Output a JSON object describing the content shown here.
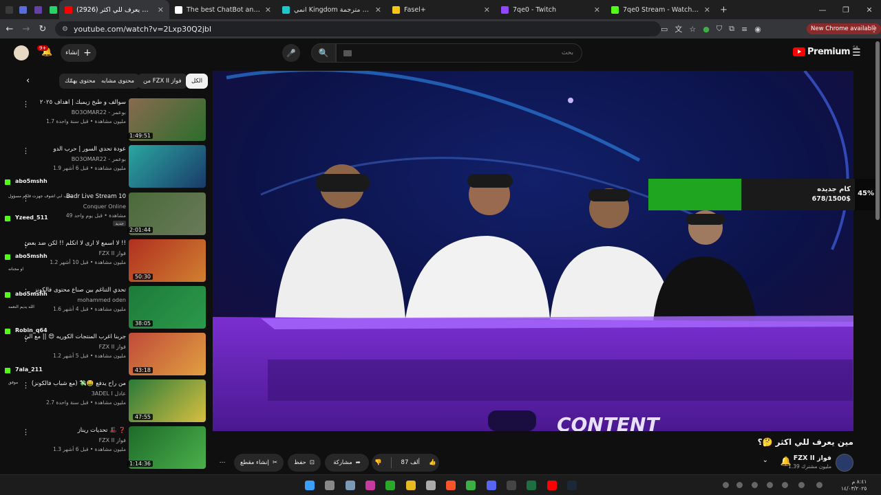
{
  "browser": {
    "tabs": [
      {
        "label": "",
        "color": "#3a3a3a",
        "active": false
      },
      {
        "label": "",
        "color": "#5a6cd8",
        "active": false
      },
      {
        "label": "",
        "color": "#6441a5",
        "active": false
      },
      {
        "label": "",
        "color": "#25d366",
        "active": false
      },
      {
        "label": "(2926) مين يعرف للي اكثر 🤔",
        "color": "#ff0000",
        "active": true
      },
      {
        "label": "The best ChatBot and Widgets",
        "color": "#ffffff",
        "active": false
      },
      {
        "label": "انمي Kingdom الحلقة 10 مترجمة",
        "color": "#1ec8c8",
        "active": false
      },
      {
        "label": "Fasel+",
        "color": "#f5c518",
        "active": false
      },
      {
        "label": "7qe0 - Twitch",
        "color": "#9146ff",
        "active": false
      },
      {
        "label": "7qe0 Stream - Watch Live on K",
        "color": "#53fc18",
        "active": false
      }
    ],
    "url": "youtube.com/watch?v=2Lxp30Q2jbI",
    "new_chrome": "New Chrome available"
  },
  "youtube": {
    "notif_count": "9+",
    "create_label": "إنشاء",
    "search_placeholder": "بحث",
    "logo_text": "Premium",
    "logo_region": "SA"
  },
  "chips": [
    "الكل",
    "من FZX II فواز",
    "محتوى مشابه",
    "محتوى يهمّك"
  ],
  "related": [
    {
      "title": "سوالف و طبخ زيمبك | اهداف ٢٠٢٥",
      "channel": "BO3OMAR22 - بوعمر",
      "meta": "1.7 مليون مشاهدة • قبل سنة واحدة",
      "duration": "1:49:51",
      "colors": [
        "#8a6a50",
        "#2b6e2b"
      ]
    },
    {
      "title": "عودة تحدي السور | حرب الدو",
      "channel": "BO3OMAR22 - بوعمر",
      "meta": "1.9 مليون مشاهدة • قبل 6 أشهر",
      "duration": "",
      "colors": [
        "#2aa7a0",
        "#1a3a6a"
      ]
    },
    {
      "title": "Badr Live Stream 10",
      "channel": "Conquer Online",
      "meta": "49 مشاهدة • قبل يوم واحد",
      "duration": "2:01:44",
      "badge": "جديد",
      "colors": [
        "#4a6a3a",
        "#6a7a5a"
      ]
    },
    {
      "title": "لا اسمع لا ارى لا اتكلم !! لكن ضد بعض !!",
      "channel": "FZX II فواز",
      "meta": "1.2 مليون مشاهدة • قبل 10 أشهر",
      "duration": "50:30",
      "colors": [
        "#b03020",
        "#d08030"
      ]
    },
    {
      "title": "تحدي التناغم بين صناع محتوى فالكونز",
      "channel": "mohammed oden",
      "meta": "1.6 مليون مشاهدة • قبل 4 أشهر",
      "duration": "38:05",
      "colors": [
        "#1e7a3a",
        "#2a9a4a"
      ]
    },
    {
      "title": "جربنا اغرب المنتجات الكوريه 😍 || مع الي",
      "channel": "FZX II فواز",
      "meta": "1.2 مليون مشاهدة • قبل 5 أشهر",
      "duration": "43:18",
      "colors": [
        "#c04a3a",
        "#e0a040"
      ]
    },
    {
      "title": "من راح يدفع 🤑💸 (مع شباب فالكونز)",
      "channel": "3ADEL I عادل",
      "meta": "2.7 مليون مشاهدة • قبل سنة واحدة",
      "duration": "47:55",
      "colors": [
        "#2a7a3a",
        "#d8c040"
      ]
    },
    {
      "title": "تحديات ريناز 🎩 ❓",
      "channel": "FZX II فواز",
      "meta": "1.3 مليون مشاهدة • قبل 6 أشهر",
      "duration": "1:14:36",
      "colors": [
        "#1e6a2a",
        "#4ab04a"
      ]
    }
  ],
  "chat": [
    {
      "name": "abo5mshh",
      "text": ""
    },
    {
      "name": "",
      "text": "طيب ابي اشوف جهزت فلكم مسؤول"
    },
    {
      "name": "Yzeed_511",
      "text": ""
    },
    {
      "name": "abo5mshh",
      "text": "او مجنانه"
    },
    {
      "name": "abo5mshh",
      "text": "الله يديم النعمه"
    },
    {
      "name": "Robin_q64",
      "text": ""
    },
    {
      "name": "7ala_211",
      "text": "موفق"
    }
  ],
  "donation": {
    "label": "كام جديده",
    "amount": "678/1500$",
    "percent": "45%",
    "fraction": 0.45,
    "color": "#1fa51f"
  },
  "video": {
    "title": "مين يعرف للي اكثر 🤔؟",
    "channel": "FZX II فواز",
    "subscribers": "1.39 مليون مشترك",
    "likes": "87 ألف",
    "share": "مشاركة",
    "save": "حفظ",
    "clip": "إنشاء مقطع"
  },
  "taskbar": {
    "time": "٨:٤١ م",
    "date": "١٤/٠٣/٢٠٢٥"
  }
}
